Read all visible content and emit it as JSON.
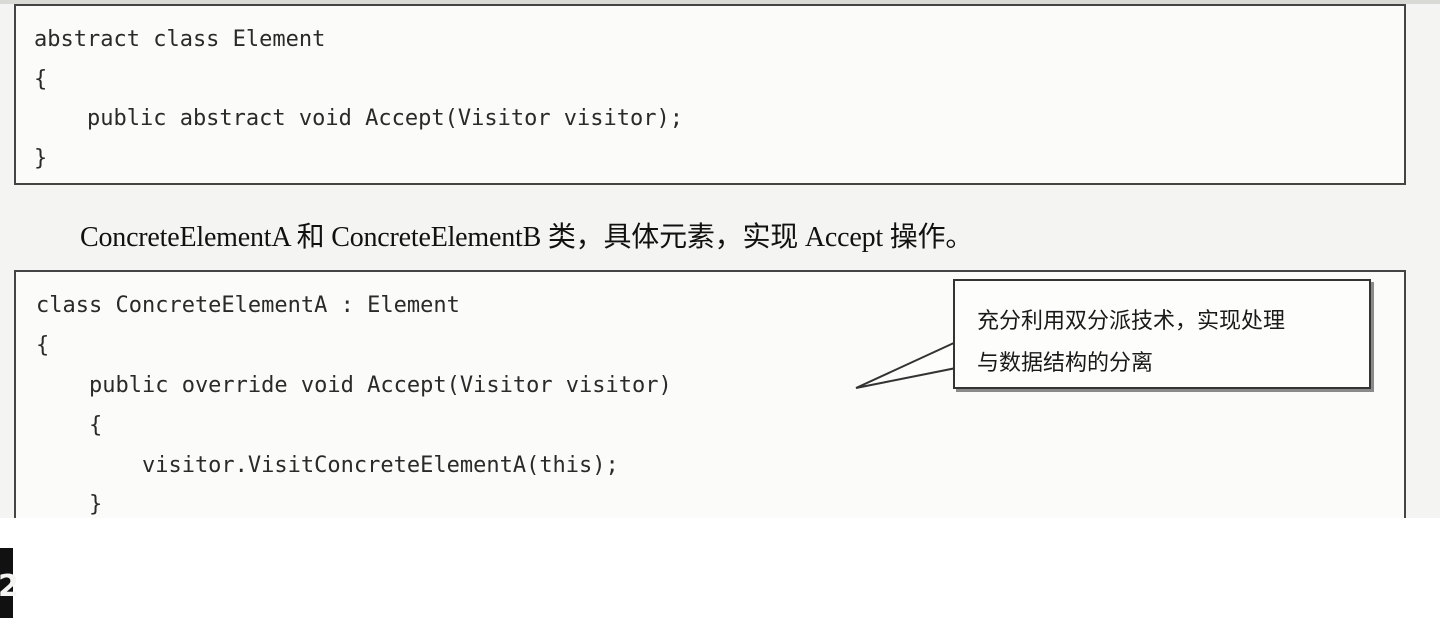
{
  "code_block_1": {
    "lines": [
      "abstract class Element",
      "{",
      "    public abstract void Accept(Visitor visitor);",
      "}"
    ]
  },
  "paragraph": {
    "text": "ConcreteElementA 和 ConcreteElementB 类，具体元素，实现 Accept 操作。"
  },
  "code_block_2": {
    "lines": [
      "class ConcreteElementA : Element",
      "{",
      "    public override void Accept(Visitor visitor)",
      "    {",
      "        visitor.VisitConcreteElementA(this);",
      "    }"
    ]
  },
  "callout": {
    "lines": [
      "充分利用双分派技术，实现处理",
      "与数据结构的分离"
    ]
  },
  "side_tab": {
    "label": "2"
  }
}
